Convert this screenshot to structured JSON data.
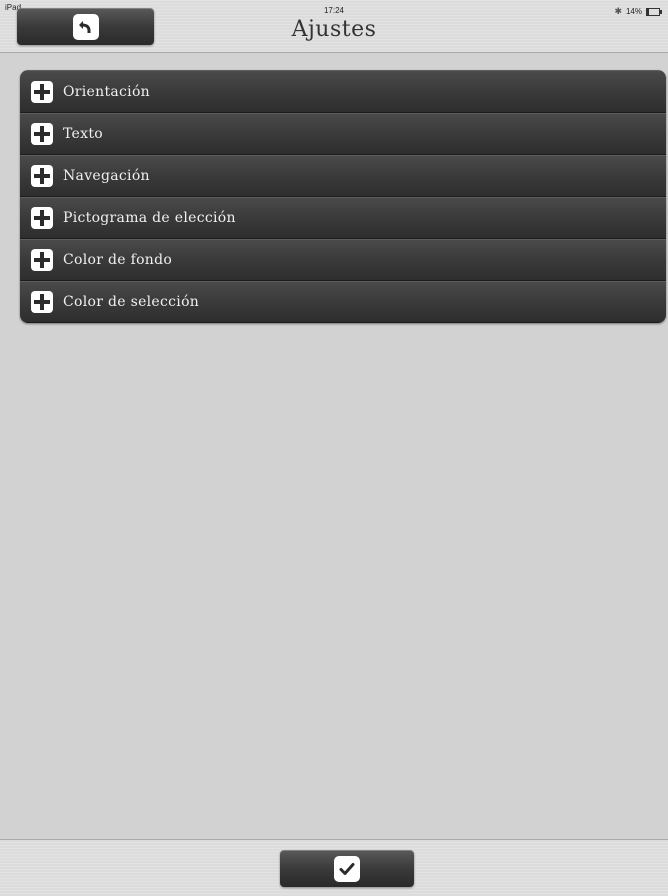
{
  "status_bar": {
    "carrier": "iPad",
    "time": "17:24",
    "battery": "14%"
  },
  "navbar": {
    "title": "Ajustes",
    "back_button_icon": "back-arrow-icon"
  },
  "settings": {
    "items": [
      {
        "label": "Orientación",
        "icon": "plus-icon"
      },
      {
        "label": "Texto",
        "icon": "plus-icon"
      },
      {
        "label": "Navegación",
        "icon": "plus-icon"
      },
      {
        "label": "Pictograma de elección",
        "icon": "plus-icon"
      },
      {
        "label": "Color de fondo",
        "icon": "plus-icon"
      },
      {
        "label": "Color de selección",
        "icon": "plus-icon"
      }
    ]
  },
  "toolbar": {
    "confirm_icon": "checkmark-icon"
  },
  "colors": {
    "background": "#d2d2d2",
    "list_item": "#3a3a3a",
    "list_text": "#f0f0f0",
    "title_text": "#333333"
  }
}
